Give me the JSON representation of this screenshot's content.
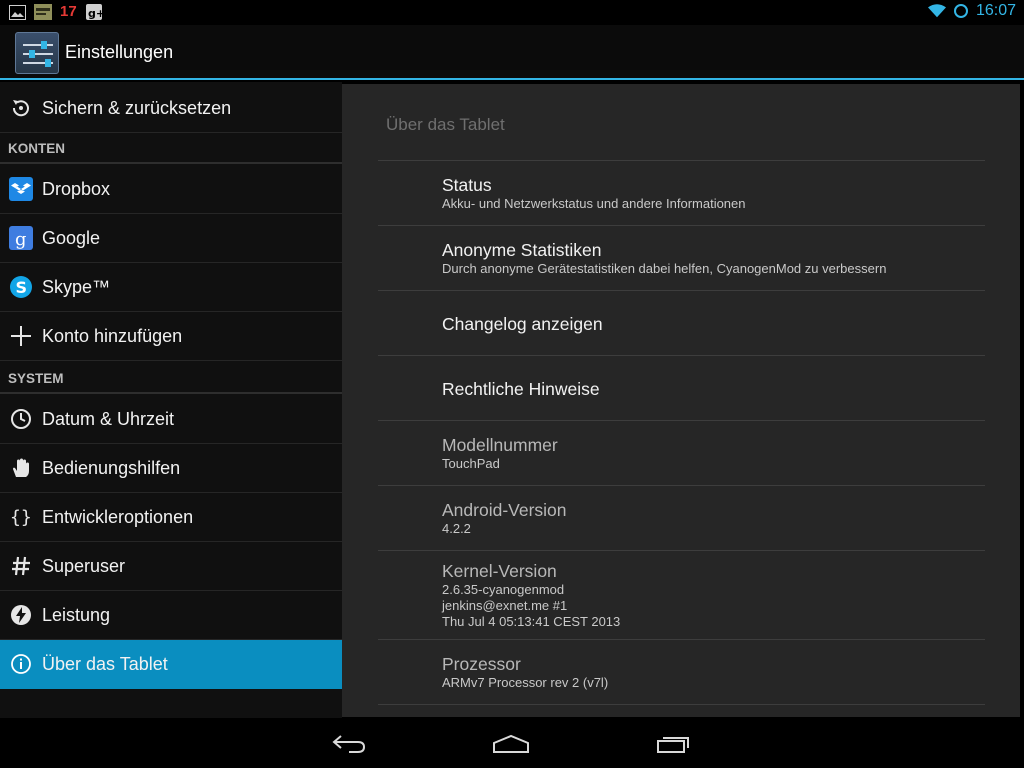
{
  "status_bar": {
    "icons_left": [
      "image-notification-icon",
      "jenkins-notification-icon",
      "calendar-notification-icon",
      "google-plus-notification-icon"
    ],
    "calendar_day": "17",
    "icons_right": [
      "wifi-icon",
      "sync-icon"
    ],
    "time": "16:07"
  },
  "action_bar": {
    "app_icon": "settings-sliders-icon",
    "title": "Einstellungen"
  },
  "sidebar": {
    "items": [
      {
        "label": "Sichern & zurücksetzen",
        "icon": "backup-restore-icon"
      },
      {
        "label": "Dropbox",
        "icon": "dropbox-icon"
      },
      {
        "label": "Google",
        "icon": "google-icon"
      },
      {
        "label": "Skype™",
        "icon": "skype-icon"
      },
      {
        "label": "Konto hinzufügen",
        "icon": "plus-icon"
      },
      {
        "label": "Datum & Uhrzeit",
        "icon": "clock-icon"
      },
      {
        "label": "Bedienungshilfen",
        "icon": "hand-icon"
      },
      {
        "label": "Entwickleroptionen",
        "icon": "braces-icon"
      },
      {
        "label": "Superuser",
        "icon": "hash-icon"
      },
      {
        "label": "Leistung",
        "icon": "performance-icon"
      },
      {
        "label": "Über das Tablet",
        "icon": "info-icon"
      }
    ],
    "headers": {
      "accounts": "KONTEN",
      "system": "SYSTEM"
    },
    "selected_label": "Über das Tablet"
  },
  "detail": {
    "title": "Über das Tablet",
    "items": [
      {
        "title": "Status",
        "summary": "Akku- und Netzwerkstatus und andere Informationen"
      },
      {
        "title": "Anonyme Statistiken",
        "summary": "Durch anonyme Gerätestatistiken dabei helfen, CyanogenMod zu verbessern"
      },
      {
        "title": "Changelog anzeigen",
        "summary": ""
      },
      {
        "title": "Rechtliche Hinweise",
        "summary": ""
      },
      {
        "title": "Modellnummer",
        "summary": "TouchPad"
      },
      {
        "title": "Android-Version",
        "summary": "4.2.2"
      },
      {
        "title": "Kernel-Version",
        "summary_lines": [
          "2.6.35-cyanogenmod",
          "jenkins@exnet.me #1",
          "Thu Jul 4 05:13:41 CEST 2013"
        ]
      },
      {
        "title": "Prozessor",
        "summary": "ARMv7 Processor rev 2 (v7l)"
      }
    ]
  },
  "nav_bar": {
    "buttons": [
      "back-icon",
      "home-icon",
      "recent-apps-icon"
    ]
  },
  "colors": {
    "accent": "#33b5e5",
    "selected_bg": "#0a8ec0",
    "panel_bg": "#262626",
    "list_bg": "#101010"
  }
}
